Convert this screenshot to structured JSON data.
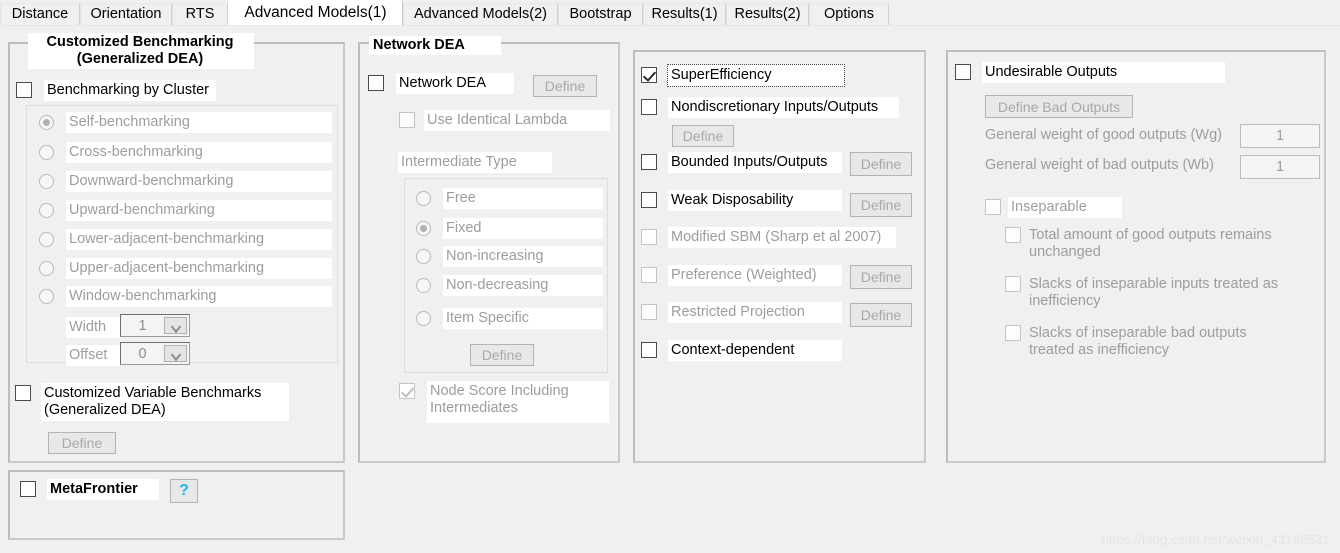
{
  "tabs": [
    {
      "label": "Distance",
      "active": false
    },
    {
      "label": "Orientation",
      "active": false
    },
    {
      "label": "RTS",
      "active": false
    },
    {
      "label": "Advanced Models(1)",
      "active": true
    },
    {
      "label": "Advanced Models(2)",
      "active": false
    },
    {
      "label": "Bootstrap",
      "active": false
    },
    {
      "label": "Results(1)",
      "active": false
    },
    {
      "label": "Results(2)",
      "active": false
    },
    {
      "label": "Options",
      "active": false
    }
  ],
  "panel_benchmarking": {
    "title": "Customized Benchmarking\n(Generalized DEA)",
    "cluster_checkbox": "Benchmarking by Cluster",
    "radios": [
      "Self-benchmarking",
      "Cross-benchmarking",
      "Downward-benchmarking",
      "Upward-benchmarking",
      "Lower-adjacent-benchmarking",
      "Upper-adjacent-benchmarking",
      "Window-benchmarking"
    ],
    "selected_radio": "Self-benchmarking",
    "width_label": "Width",
    "width_value": "1",
    "offset_label": "Offset",
    "offset_value": "0",
    "variable_benchmarks": "Customized Variable Benchmarks\n(Generalized DEA)",
    "define_label": "Define"
  },
  "panel_network": {
    "title": "Network DEA",
    "network_dea": "Network DEA",
    "define_label": "Define",
    "identical_lambda": "Use Identical Lambda",
    "intermediate_type": "Intermediate Type",
    "intermediate_radios": [
      "Free",
      "Fixed",
      "Non-increasing",
      "Non-decreasing",
      "Item Specific"
    ],
    "selected_intermediate": "Fixed",
    "define_inner_label": "Define",
    "node_score": "Node Score Including Intermediates"
  },
  "panel_advanced": {
    "items": [
      {
        "label": "SuperEfficiency",
        "checked": true,
        "disabled": false,
        "focused": true,
        "define": null
      },
      {
        "label": "Nondiscretionary Inputs/Outputs",
        "checked": false,
        "disabled": false,
        "define": "Define"
      },
      {
        "label": "Bounded Inputs/Outputs",
        "checked": false,
        "disabled": false,
        "define": "Define"
      },
      {
        "label": "Weak Disposability",
        "checked": false,
        "disabled": false,
        "define": "Define"
      },
      {
        "label": "Modified SBM (Sharp et al 2007)",
        "checked": false,
        "disabled": true,
        "define": null
      },
      {
        "label": "Preference (Weighted)",
        "checked": false,
        "disabled": true,
        "define": "Define"
      },
      {
        "label": "Restricted Projection",
        "checked": false,
        "disabled": true,
        "define": "Define"
      },
      {
        "label": "Context-dependent",
        "checked": false,
        "disabled": false,
        "define": null
      }
    ]
  },
  "panel_undesirable": {
    "undesirable_outputs": "Undesirable Outputs",
    "define_bad_outputs": "Define Bad Outputs",
    "wg_label": "General weight of good outputs (Wg)",
    "wg_value": "1",
    "wb_label": "General weight of bad outputs (Wb)",
    "wb_value": "1",
    "inseparable": "Inseparable",
    "sub_items": [
      "Total amount of good outputs remains unchanged",
      "Slacks of inseparable inputs treated as inefficiency",
      "Slacks of inseparable bad outputs treated as inefficiency"
    ]
  },
  "panel_metafrontier": {
    "label": "MetaFrontier",
    "help_label": "?"
  },
  "watermark": "https://blog.csdn.net/weixin_43196531"
}
